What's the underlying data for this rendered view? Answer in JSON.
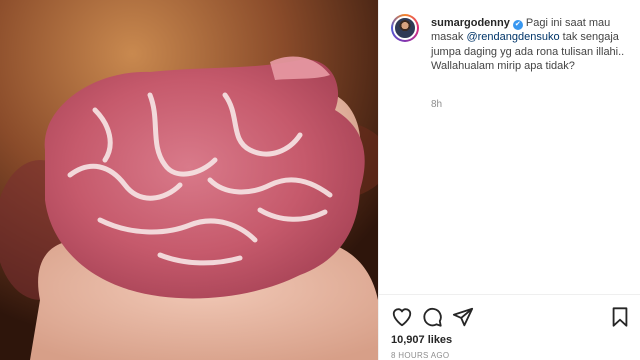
{
  "post": {
    "photo_alt": "",
    "username": "sumargodenny",
    "verified_badge": "✔",
    "caption_line1": " Pagi ini saat mau masak ",
    "mention": "@rendangdensuko",
    "caption_line2": " tak sengaja jumpa daging yg ada rona tulisan illahi..",
    "caption_line3": "Wallahualam mirip apa tidak?",
    "time_ago": "8h",
    "likes": "10,907 likes",
    "posted_ago": "8 HOURS AGO"
  },
  "icons": {
    "like": "heart-icon",
    "comment": "comment-icon",
    "share": "share-icon",
    "save": "bookmark-icon"
  },
  "colors": {
    "link": "#003569",
    "verified": "#3897f0",
    "text": "#262626",
    "muted": "#8e8e8e"
  }
}
